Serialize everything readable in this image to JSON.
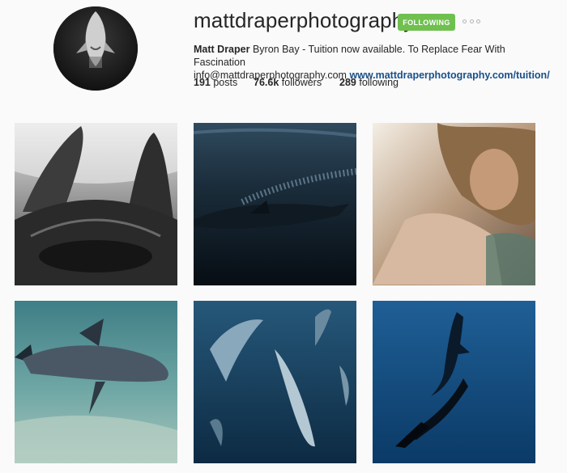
{
  "profile": {
    "username": "mattdraperphotography",
    "follow_label": "FOLLOWING",
    "more_icon": "ellipsis-icon",
    "full_name": "Matt Draper",
    "bio_text": " Byron Bay - Tuition now available. To Replace Fear With Fascination",
    "email": "info@mattdraperphotography.com",
    "website": "www.mattdraperphotography.com/tuition/",
    "accent_color": "#70c050",
    "link_color": "#1a4f8a"
  },
  "stats": {
    "posts_count": "191",
    "posts_label": "posts",
    "followers_count": "76.6k",
    "followers_label": "followers",
    "following_count": "289",
    "following_label": "following"
  },
  "posts": [
    {
      "subject": "manta ray silhouette black and white"
    },
    {
      "subject": "sea lion swimming underwater dark"
    },
    {
      "subject": "surfer selfie portrait"
    },
    {
      "subject": "sea lion over sandy seafloor"
    },
    {
      "subject": "pod of dolphins"
    },
    {
      "subject": "freediver and orca"
    }
  ]
}
